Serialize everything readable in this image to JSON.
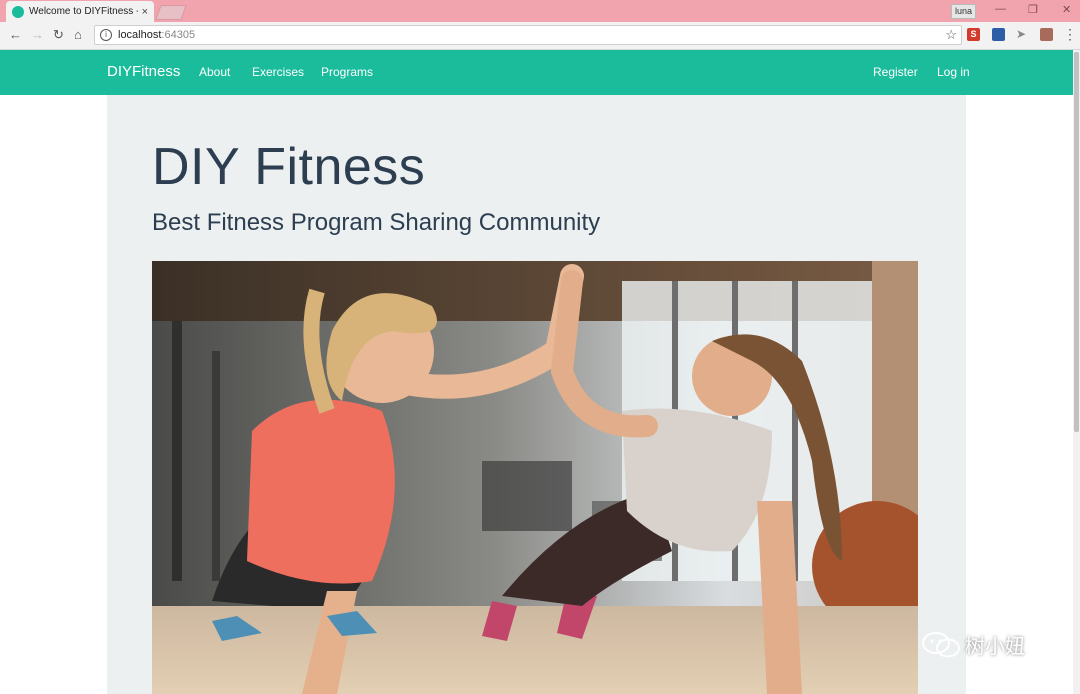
{
  "browser": {
    "tab_title": "Welcome to DIYFitness -",
    "tab_close": "×",
    "user_badge": "luna",
    "window_controls": [
      "—",
      "❐",
      "✕"
    ],
    "address": {
      "host": "localhost",
      "port": ":64305"
    },
    "extensions": [
      "s-extension-icon",
      "blue-extension-icon",
      "bird-extension-icon",
      "puzzle-extension-icon"
    ]
  },
  "navbar": {
    "brand": "DIYFitness",
    "links": [
      "About",
      "Exercises",
      "Programs"
    ],
    "right_links": [
      "Register",
      "Log in"
    ],
    "color": "#1abc9c"
  },
  "hero": {
    "title": "DIY Fitness",
    "subtitle": "Best Fitness Program Sharing Community",
    "image": "two-women-high-five-gym-photo"
  },
  "watermark": {
    "text": "树小妞"
  },
  "colors": {
    "accent": "#1abc9c",
    "jumbotron_bg": "#ecf0f1",
    "heading": "#2c3e50",
    "titlebar": "#f2a4ae"
  }
}
